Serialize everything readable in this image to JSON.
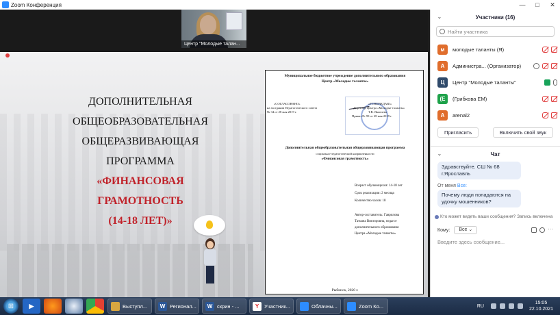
{
  "window": {
    "title": "Zoom Конференция",
    "controls": [
      "—",
      "□",
      "✕"
    ]
  },
  "video": {
    "participant_name": "Центр \"Молодые талан..."
  },
  "slide": {
    "lines": [
      "ДОПОЛНИТЕЛЬНАЯ",
      "ОБЩЕОБРАЗОВАТЕЛЬНАЯ",
      "ОБЩЕРАЗВИВАЮЩАЯ",
      "ПРОГРАММА"
    ],
    "red_lines": [
      "«ФИНАНСОВАЯ",
      "ГРАМОТНОСТЬ",
      "(14-18 ЛЕТ)»"
    ]
  },
  "document": {
    "org_line1": "Муниципальное бюджетное учреждение дополнительного образования",
    "org_line2": "Центр «Молодые таланты»",
    "agreed_title": "«СОГЛАСОВАНО»",
    "agreed_text1": "на заседании Педагогического совета",
    "agreed_text2": "№ 34 от 28 мая 2019 г.",
    "approved_title": "«УТВЕРЖДАЮ»",
    "approved_text1": "Директор Центра «Молодые таланты»",
    "approved_text2": "Т.В. Яковлева",
    "approved_text3": "Приказ № 99 от 28 мая 2019 г.",
    "program_title": "Дополнительная общеобразовательная общеразвивающая программа",
    "program_sub": "социально-педагогической направленности",
    "program_name": "«Финансовая грамотность»",
    "age": "Возраст обучающихся: 14-18 лет",
    "term": "Срок реализации: 2 месяца",
    "hours": "Количество часов: 18",
    "author1": "Автор-составитель: Гаврилова",
    "author2": "Татьяна Викторовна, педагог",
    "author3": "дополнительного образования",
    "author4": "Центра «Молодые таланты»",
    "footer": "Рыбинск, 2020 г."
  },
  "participants": {
    "header": "Участники (16)",
    "search_placeholder": "Найти участника",
    "items": [
      {
        "initial": "м",
        "name": "молодые таланты (Я)",
        "color": "#e06d2c"
      },
      {
        "initial": "А",
        "name": "Администра... (Организатор)",
        "color": "#e06d2c"
      },
      {
        "initial": "Ц",
        "name": "Центр \"Молодые таланты\"",
        "color": "#2f4a6a"
      },
      {
        "initial": "(Е",
        "name": "(Грибкова ЕМ)",
        "color": "#1ea24a"
      },
      {
        "initial": "А",
        "name": "arenal2",
        "color": "#e06d2c"
      }
    ],
    "invite_label": "Пригласить",
    "unmute_label": "Включить свой звук"
  },
  "chat": {
    "header": "Чат",
    "msg1": "Здравствуйте. СШ № 68 г.Ярославль",
    "from_prefix": "От меня",
    "from_to": "Все:",
    "msg2": "Почему люди попадаются на удочку мошенников?",
    "notice": "Кто может видеть ваши сообщения? Запись включена",
    "to_label": "Кому:",
    "to_value": "Все",
    "input_placeholder": "Введите здесь сообщение..."
  },
  "taskbar": {
    "items": [
      {
        "label": "Выступл...",
        "color": "#d8a640",
        "glyph": ""
      },
      {
        "label": "Регионал...",
        "color": "#2b5797",
        "glyph": "W"
      },
      {
        "label": "скрин - ...",
        "color": "#2b5797",
        "glyph": "W"
      },
      {
        "label": "Участник...",
        "color": "#ffffff",
        "glyph": "Y"
      },
      {
        "label": "Облачны...",
        "color": "#2d8cff",
        "glyph": ""
      },
      {
        "label": "Zoom Ко...",
        "color": "#2d8cff",
        "glyph": ""
      }
    ],
    "lang": "RU",
    "time": "15:05",
    "date": "22.10.2021"
  }
}
